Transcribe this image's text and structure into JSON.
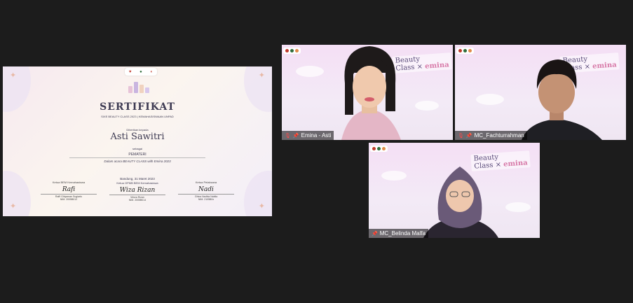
{
  "certificate": {
    "title": "SERTIFIKAT",
    "subtitle": "SIXE BEAUTY CLASS 2023 | KEMAHASISWAAN UNPAD",
    "given_to": "Diberikan kepada",
    "recipient": "Asti Sawitri",
    "as_label": "sebagai",
    "role": "PEMATERI",
    "event_line": "Dalam acara BEAUTY CLASS with Emina 2023",
    "date_line": "Bandung, 31 Maret 2023",
    "center_role": "Ketua OPMB BEM Kemahasiswa",
    "left_signer": {
      "role": "Ketua BEM Kemahasiswa",
      "signature": "Rafi",
      "name": "Rafif Ghiyaman Sugiarto",
      "nim": "NIM. 2005B012"
    },
    "center_signer": {
      "signature": "Wiza Rizan",
      "name": "Wizza Rizan",
      "nim": "NIM. 2005B014"
    },
    "right_signer": {
      "role": "Ketua Pelaksana",
      "signature": "Nadi",
      "name": "Ghina Nadhia Nabila",
      "nim": "NIM. 2105B0x"
    }
  },
  "participants": [
    {
      "name": "Emina - Asti",
      "banner_top": "Beauty",
      "banner_bottom": "Class",
      "brand": "emina"
    },
    {
      "name": "MC_Fachturrahman",
      "banner_top": "Beauty",
      "banner_bottom": "Class",
      "brand": "emina"
    },
    {
      "name": "MC_Belinda Malfa",
      "banner_top": "Beauty",
      "banner_bottom": "Class",
      "brand": "emina"
    }
  ],
  "colors": {
    "background": "#1c1c1c",
    "mic_muted": "#ff4a4a",
    "brand_pink": "#d77aa8"
  },
  "icons": [
    "mic-muted-icon",
    "pin-icon"
  ]
}
